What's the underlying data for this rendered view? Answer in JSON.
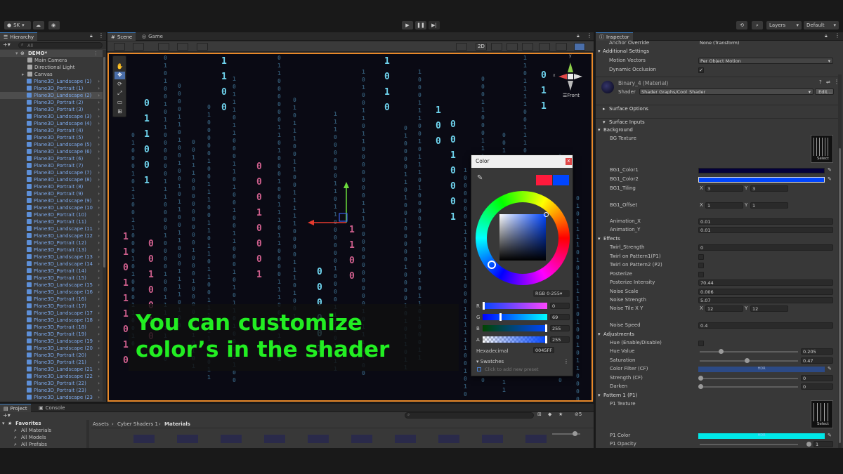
{
  "toolbar": {
    "account": "SK",
    "layers": "Layers",
    "layout": "Default"
  },
  "hierarchy": {
    "tab": "Hierarchy",
    "search_placeholder": "All",
    "scene": "DEMO*",
    "top_items": [
      "Main Camera",
      "Directional Light",
      "Canvas"
    ],
    "items": [
      "Plane3D_Landscape (1)",
      "Plane3D_Portrait (1)",
      "Plane3D_Landscape (2)",
      "Plane3D_Portrait (2)",
      "Plane3D_Portrait (3)",
      "Plane3D_Landscape (3)",
      "Plane3D_Landscape (4)",
      "Plane3D_Portrait (4)",
      "Plane3D_Portrait (5)",
      "Plane3D_Landscape (5)",
      "Plane3D_Landscape (6)",
      "Plane3D_Portrait (6)",
      "Plane3D_Portrait (7)",
      "Plane3D_Landscape (7)",
      "Plane3D_Landscape (8)",
      "Plane3D_Portrait (8)",
      "Plane3D_Portrait (9)",
      "Plane3D_Landscape (9)",
      "Plane3D_Landscape (10",
      "Plane3D_Portrait (10)",
      "Plane3D_Portrait (11)",
      "Plane3D_Landscape (11",
      "Plane3D_Landscape (12",
      "Plane3D_Portrait (12)",
      "Plane3D_Portrait (13)",
      "Plane3D_Landscape (13",
      "Plane3D_Landscape (14",
      "Plane3D_Portrait (14)",
      "Plane3D_Portrait (15)",
      "Plane3D_Landscape (15",
      "Plane3D_Landscape (16",
      "Plane3D_Portrait (16)",
      "Plane3D_Portrait (17)",
      "Plane3D_Landscape (17",
      "Plane3D_Landscape (18",
      "Plane3D_Portrait (18)",
      "Plane3D_Portrait (19)",
      "Plane3D_Landscape (19",
      "Plane3D_Landscape (20",
      "Plane3D_Portrait (20)",
      "Plane3D_Portrait (21)",
      "Plane3D_Landscape (21",
      "Plane3D_Landscape (22",
      "Plane3D_Portrait (22)",
      "Plane3D_Portrait (23)",
      "Plane3D_Landscape (23"
    ]
  },
  "scene": {
    "tab_scene": "Scene",
    "tab_game": "Game",
    "btn_2d": "2D",
    "gizmo_front": "Front",
    "gizmo_axis_x": "x",
    "gizmo_axis_y": "y",
    "overlay_line1": "You can customize",
    "overlay_line2": "color’s in the shader"
  },
  "color_picker": {
    "title": "Color",
    "close": "x",
    "mode": "RGB 0-255",
    "r_label": "R",
    "r_value": "0",
    "g_label": "G",
    "g_value": "69",
    "b_label": "B",
    "b_value": "255",
    "a_label": "A",
    "a_value": "255",
    "hex_label": "Hexadecimal",
    "hex_value": "0045FF",
    "swatches_label": "Swatches",
    "swatches_hint": "Click to add new preset",
    "colors": {
      "previous": "#ff1a3c",
      "current": "#0045ff"
    }
  },
  "inspector": {
    "tab": "Inspector",
    "anchor_label": "Anchor Override",
    "anchor_value": "None (Transform)",
    "additional_settings": "Additional Settings",
    "motion_vectors_label": "Motion Vectors",
    "motion_vectors_value": "Per Object Motion",
    "dynamic_occlusion_label": "Dynamic Occlusion",
    "material_name": "Binary_4 (Material)",
    "shader_label": "Shader",
    "shader_value": "Shader Graphs/Cool_Shader",
    "edit_button": "Edit...",
    "surface_options": "Surface Options",
    "surface_inputs": "Surface Inputs",
    "background": "Background",
    "bg_texture": "BG Texture",
    "select": "Select",
    "bg1_color1": "BG1_Color1",
    "bg1_color2": "BG1_Color2",
    "bg1_tiling": "BG1_Tiling",
    "bg1_offset": "BG1_Offset",
    "x": "X",
    "y": "Y",
    "tiling_x": "3",
    "tiling_y": "3",
    "offset_x": "1",
    "offset_y": "1",
    "animation_x_label": "Animation_X",
    "animation_x": "0.01",
    "animation_y_label": "Animation_Y",
    "animation_y": "0.01",
    "effects": "Effects",
    "twirl_strength_label": "Twirl_Strength",
    "twirl_strength": "0",
    "twirl_p1": "Twirl on Pattern1(P1)",
    "twirl_p2": "Twirl on Pattern2 (P2)",
    "posterize": "Posterize",
    "posterize_intensity_label": "Posterize Intensity",
    "posterize_intensity": "70.44",
    "noise_scale_label": "Noise Scale",
    "noise_scale": "0.006",
    "noise_strength_label": "Noise Strength",
    "noise_strength": "5.07",
    "noise_tile_label": "Noise Tile X Y",
    "noise_tile_x": "12",
    "noise_tile_y": "12",
    "noise_speed_label": "Noise Speed",
    "noise_speed": "0.4",
    "adjustments": "Adjustments",
    "hue_enable": "Hue (Enable/Disable)",
    "hue_value_label": "Hue Value",
    "hue_value": "0.205",
    "hue_value_level": 0.205,
    "saturation_label": "Saturation",
    "saturation": "0.47",
    "saturation_level": 0.47,
    "color_filter_label": "Color Filter (CF)",
    "hdr": "HDR",
    "strength_cf_label": "Strength (CF)",
    "strength_cf": "0",
    "darken_label": "Darken",
    "darken": "0",
    "pattern1": "Pattern 1 (P1)",
    "p1_texture": "P1 Texture",
    "p1_color": "P1 Color",
    "p1_opacity_label": "P1 Opacity",
    "p1_opacity": "1",
    "colors": {
      "bg1_color1": "#04003a",
      "bg1_color2": "#0045ff",
      "color_filter": "#2c4a86",
      "p1_color": "#00e8e8"
    }
  },
  "project": {
    "tab_project": "Project",
    "tab_console": "Console",
    "favorites": "Favorites",
    "fav_items": [
      "All Materials",
      "All Models",
      "All Prefabs"
    ],
    "breadcrumb": [
      "Assets",
      "Cyber Shaders 1",
      "Materials"
    ],
    "hidden_count": "5"
  },
  "colors": {
    "accent": "#3a79bb",
    "scene_border": "#e8892a",
    "overlay_text": "#22ee22"
  }
}
